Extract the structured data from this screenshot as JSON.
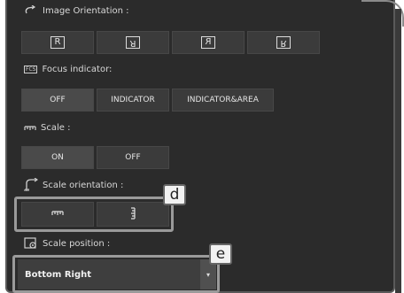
{
  "image_orientation": {
    "label": "Image Orientation :",
    "icon": "rotate-icon",
    "buttons": [
      {
        "glyph": "R",
        "transform": "none"
      },
      {
        "glyph": "R",
        "transform": "rotate180"
      },
      {
        "glyph": "R",
        "transform": "mirror"
      },
      {
        "glyph": "R",
        "transform": "flipv"
      }
    ]
  },
  "focus_indicator": {
    "label": "Focus indicator:",
    "icon": "fcs-icon",
    "icon_text": "FCS",
    "options": [
      "OFF",
      "INDICATOR",
      "INDICATOR&AREA"
    ]
  },
  "scale": {
    "label": "Scale :",
    "icon": "ruler-icon",
    "options": [
      "ON",
      "OFF"
    ]
  },
  "scale_orientation": {
    "label": "Scale orientation :",
    "icon": "scale-orientation-icon",
    "options": [
      "horizontal-scale-icon",
      "vertical-scale-icon"
    ],
    "callout": "d"
  },
  "scale_position": {
    "label": "Scale position :",
    "icon": "scale-position-icon",
    "value": "Bottom Right",
    "callout": "e"
  }
}
